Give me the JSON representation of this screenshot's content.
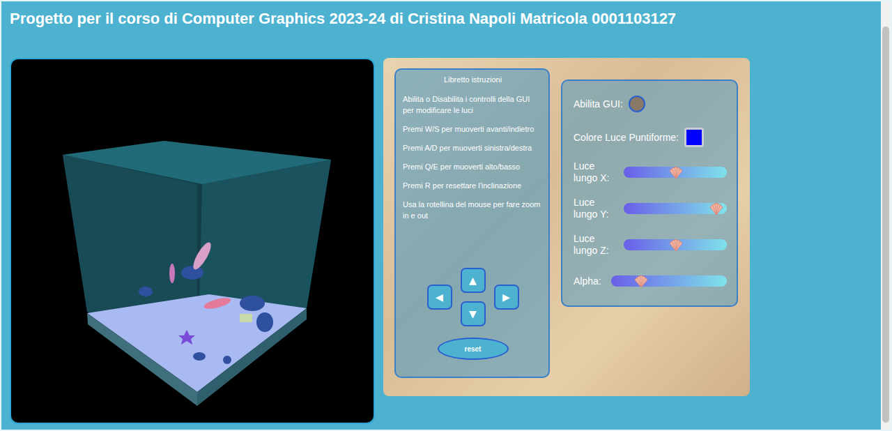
{
  "page": {
    "title": "Progetto per il corso di Computer Graphics 2023-24 di Cristina Napoli Matricola 0001103127"
  },
  "instructions": {
    "heading": "Libretto istruzioni",
    "lines": [
      "Abilita o Disabilita i controlli della GUI per modificare le luci",
      "Premi W/S per muoverti avanti/indietro",
      "Premi A/D per muoverti sinistra/destra",
      "Premi Q/E per muoverti alto/basso",
      "Premi R per resettare l'inclinazione",
      "Usa la rotellina del mouse per fare zoom in e out"
    ],
    "arrows": [
      {
        "label": "▲",
        "name": "up"
      },
      {
        "label": "◀",
        "name": "left"
      },
      {
        "label": "▶",
        "name": "right"
      },
      {
        "label": "▼",
        "name": "down"
      }
    ],
    "reset": "reset"
  },
  "gui": {
    "enable": {
      "label": "Abilita GUI:",
      "on": false
    },
    "color": {
      "label": "Colore Luce Puntiforme:",
      "value": "#0000ff"
    },
    "sliders": [
      {
        "label": "Luce lungo X:",
        "level": 0.51
      },
      {
        "label": "Luce lungo Y:",
        "level": 0.9
      },
      {
        "label": "Luce lungo Z:",
        "level": 0.51
      },
      {
        "label": "Alpha:",
        "level": 0.26
      }
    ]
  }
}
